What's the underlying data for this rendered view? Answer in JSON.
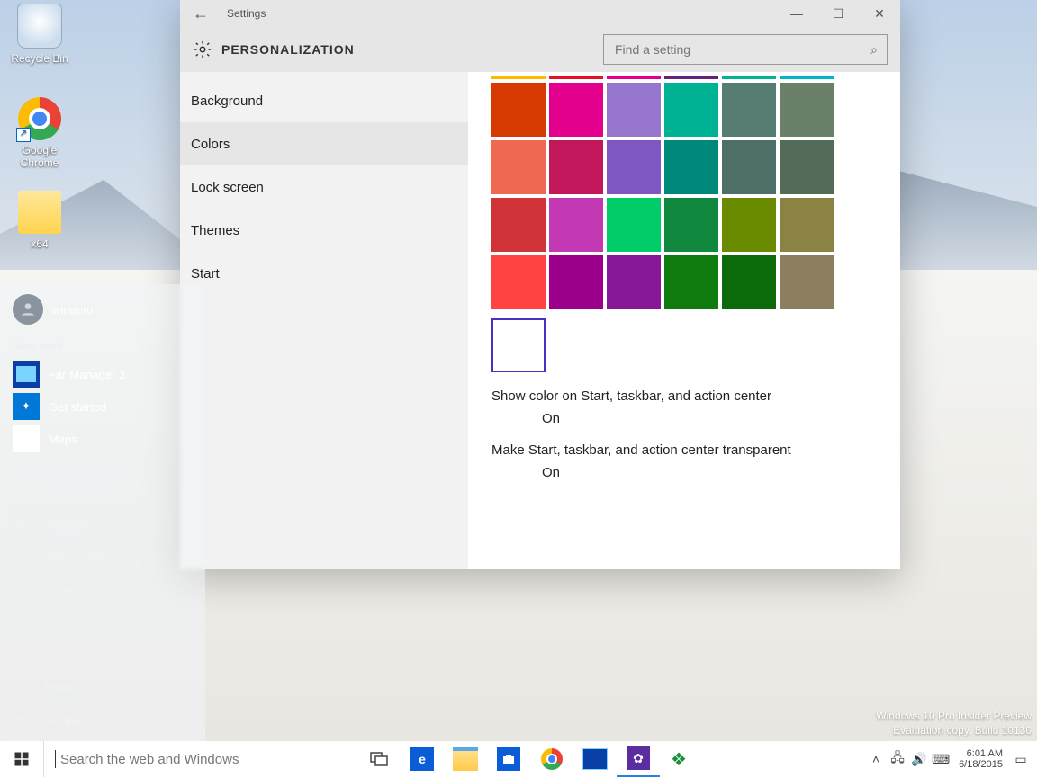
{
  "desktop_icons": [
    {
      "label": "Recycle Bin"
    },
    {
      "label": "Google Chrome"
    },
    {
      "label": "x64"
    }
  ],
  "settings": {
    "title": "Settings",
    "header": "PERSONALIZATION",
    "search_placeholder": "Find a setting",
    "nav": [
      "Background",
      "Colors",
      "Lock screen",
      "Themes",
      "Start"
    ],
    "selected_nav": "Colors",
    "row0": [
      "#ffb900",
      "#e81123",
      "#e3008c",
      "#68217a",
      "#00b294",
      "#00b7c3"
    ],
    "palette": [
      "#d13438",
      "#e3008c",
      "#8e8cd8",
      "#00b294",
      "#567c73",
      "#647c64",
      "#ef6950",
      "#bf0077",
      "#6b69d6",
      "#018574",
      "#486860",
      "#525e54",
      "#ca3b3f",
      "#c239b3",
      "#00cc6a",
      "#00cc6a",
      "#498205",
      "#847545",
      "#ff4343",
      "#9a0089",
      "#881798",
      "#107c10",
      "#107c10",
      "#7e735f"
    ],
    "opt1": "Show color on Start, taskbar, and action center",
    "opt1_val": "On",
    "opt2": "Make Start, taskbar, and action center transparent",
    "opt2_val": "On"
  },
  "start": {
    "user": "winaero",
    "most_used": "Most used",
    "apps": [
      {
        "label": "Far Manager 3",
        "bg": "#0a3fa8",
        "fg": "#7bd3ff"
      },
      {
        "label": "Get started",
        "bg": "#0078d7",
        "fg": "#fff"
      },
      {
        "label": "Maps",
        "bg": "#ffffff",
        "fg": "#333"
      }
    ],
    "links": [
      "File Explorer",
      "Settings",
      "Documents",
      "Downloads",
      "Pictures",
      "File Explorer",
      "Power",
      "All apps"
    ]
  },
  "taskbar": {
    "search_placeholder": "Search the web and Windows"
  },
  "tray": {
    "time": "6:01 AM",
    "date": "6/18/2015"
  },
  "watermark": {
    "l1": "Windows 10 Pro Insider Preview",
    "l2": "Evaluation copy. Build 10130"
  }
}
